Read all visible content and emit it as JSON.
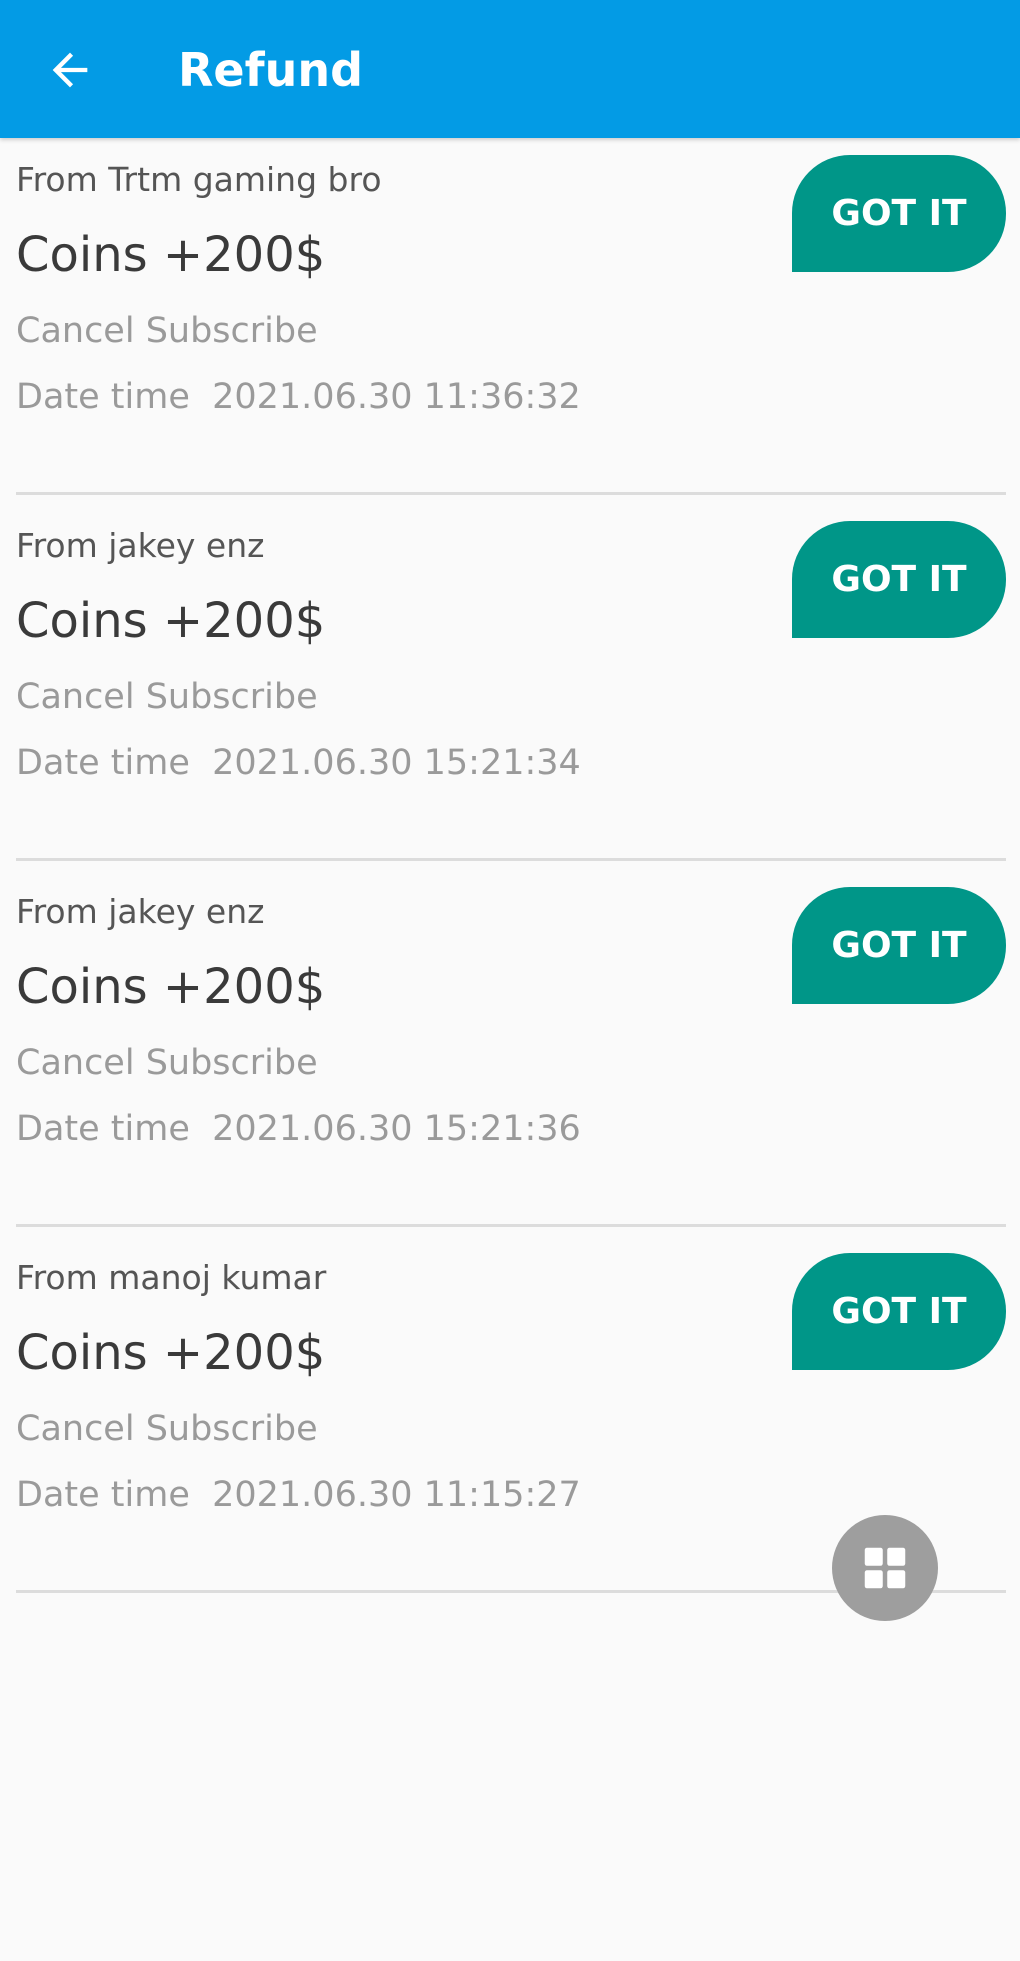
{
  "appbar": {
    "title": "Refund",
    "back_icon": "arrow-left-icon",
    "color": "#039be5"
  },
  "items": [
    {
      "from": "From Trtm gaming bro",
      "coins": "Coins +200$",
      "status": "Cancel Subscribe",
      "datetime": "Date time  2021.06.30 11:36:32",
      "button": "GOT IT"
    },
    {
      "from": "From jakey enz",
      "coins": "Coins +200$",
      "status": "Cancel Subscribe",
      "datetime": "Date time  2021.06.30 15:21:34",
      "button": "GOT IT"
    },
    {
      "from": "From jakey enz",
      "coins": "Coins +200$",
      "status": "Cancel Subscribe",
      "datetime": "Date time  2021.06.30 15:21:36",
      "button": "GOT IT"
    },
    {
      "from": "From manoj kumar",
      "coins": "Coins +200$",
      "status": "Cancel Subscribe",
      "datetime": "Date time  2021.06.30 11:15:27",
      "button": "GOT IT"
    }
  ],
  "fab": {
    "icon": "grid-icon",
    "color": "#9e9e9e"
  },
  "colors": {
    "accent_button": "#009688",
    "background": "#fafafa"
  }
}
